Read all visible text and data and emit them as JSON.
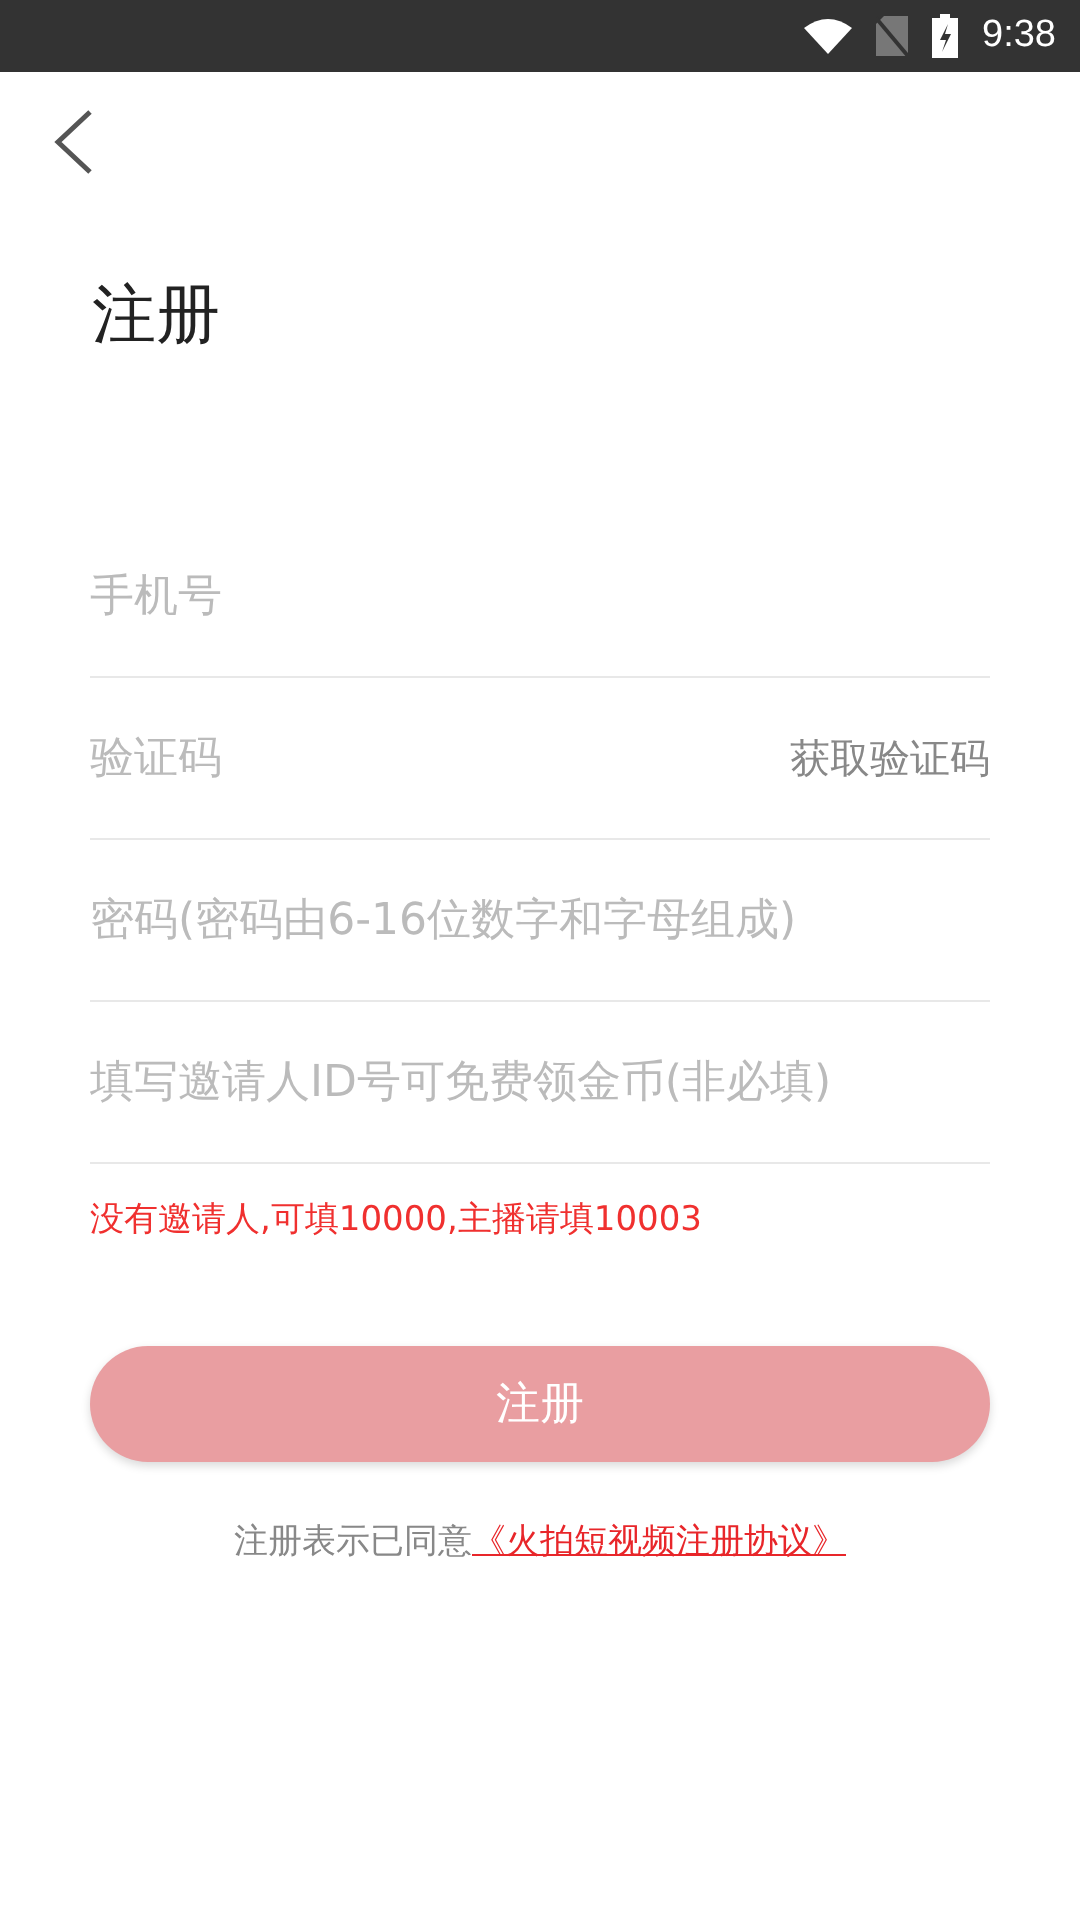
{
  "status_bar": {
    "time": "9:38"
  },
  "title": "注册",
  "fields": [
    {
      "placeholder": "手机号"
    },
    {
      "placeholder": "验证码",
      "action": "获取验证码"
    },
    {
      "placeholder": "密码(密码由6-16位数字和字母组成)"
    },
    {
      "placeholder": "填写邀请人ID号可免费领金币(非必填)"
    }
  ],
  "hint": "没有邀请人,可填10000,主播请填10003",
  "submit": {
    "label": "注册",
    "disabled": true
  },
  "agreement": {
    "text": "注册表示已同意",
    "link": "《火拍短视频注册协议》"
  }
}
